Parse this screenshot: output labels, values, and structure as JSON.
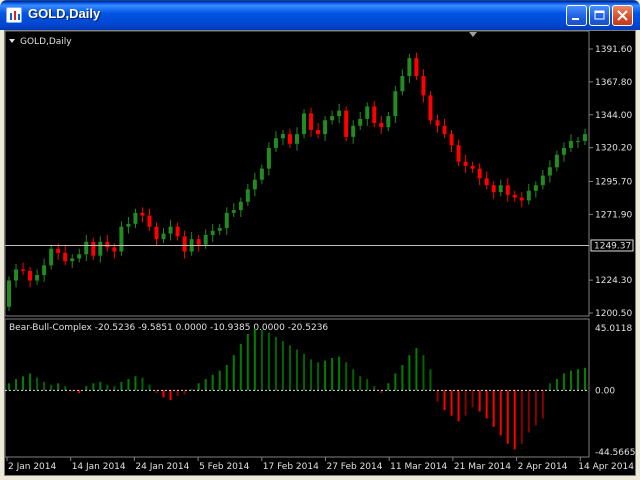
{
  "window": {
    "title": "GOLD,Daily",
    "icon": "chart-app-icon",
    "buttons": {
      "minimize": "minimize-icon",
      "maximize": "maximize-icon",
      "close": "close-icon"
    }
  },
  "main_chart": {
    "label": "GOLD,Daily",
    "current_price": "1249.37",
    "price_ticks": [
      "1391.60",
      "1367.80",
      "1344.00",
      "1320.20",
      "1295.70",
      "1271.90",
      "1249.37",
      "1224.30",
      "1200.50"
    ],
    "colors": {
      "bull": "#228b22",
      "bear": "#ff0000",
      "background": "#000000",
      "grid_line": "#c0c0c0"
    }
  },
  "indicator": {
    "label": "Bear-Bull-Complex -20.5236 -9.5851 0.0000 -10.9385 0.0000 -20.5236",
    "ticks": [
      "45.0118",
      "0.00",
      "-44.5665"
    ],
    "colors": {
      "bull_bright": "#008000",
      "bull_dark": "#006400",
      "bear_bright": "#ff0000",
      "bear_dark": "#8b0000"
    }
  },
  "time_axis": {
    "labels": [
      "2 Jan 2014",
      "14 Jan 2014",
      "24 Jan 2014",
      "5 Feb 2014",
      "17 Feb 2014",
      "27 Feb 2014",
      "11 Mar 2014",
      "21 Mar 2014",
      "2 Apr 2014",
      "14 Apr 2014"
    ]
  },
  "chart_data": [
    {
      "type": "candlestick",
      "title": "GOLD,Daily",
      "ylim": [
        1200.5,
        1391.6
      ],
      "x_start": "2 Jan 2014",
      "x_end": "15 Apr 2014",
      "close": [
        1224,
        1232,
        1231,
        1224,
        1228,
        1235,
        1247,
        1244,
        1238,
        1240,
        1243,
        1252,
        1242,
        1252,
        1248,
        1245,
        1263,
        1265,
        1273,
        1271,
        1263,
        1254,
        1258,
        1263,
        1256,
        1245,
        1254,
        1250,
        1257,
        1260,
        1262,
        1273,
        1275,
        1281,
        1290,
        1297,
        1305,
        1320,
        1327,
        1330,
        1323,
        1330,
        1345,
        1333,
        1330,
        1340,
        1343,
        1347,
        1328,
        1336,
        1341,
        1350,
        1338,
        1335,
        1343,
        1361,
        1372,
        1385,
        1372,
        1358,
        1340,
        1336,
        1330,
        1322,
        1310,
        1307,
        1305,
        1298,
        1293,
        1288,
        1293,
        1286,
        1284,
        1282,
        1289,
        1293,
        1300,
        1306,
        1315,
        1320,
        1325,
        1325,
        1330
      ]
    },
    {
      "type": "bar",
      "title": "Bear-Bull-Complex",
      "ylim": [
        -44.5665,
        45.0118
      ],
      "values": [
        5,
        8,
        10,
        12,
        9,
        6,
        4,
        5,
        3,
        -1,
        -2,
        3,
        5,
        6,
        4,
        3,
        6,
        8,
        10,
        9,
        4,
        -2,
        -5,
        -7,
        -4,
        -3,
        1,
        5,
        8,
        11,
        14,
        18,
        25,
        33,
        40,
        44,
        43,
        41,
        38,
        35,
        32,
        29,
        26,
        22,
        20,
        21,
        23,
        24,
        20,
        15,
        10,
        8,
        3,
        -2,
        5,
        12,
        18,
        25,
        30,
        25,
        15,
        -8,
        -14,
        -18,
        -22,
        -18,
        -12,
        -15,
        -20,
        -26,
        -32,
        -38,
        -42,
        -38,
        -30,
        -25,
        -20,
        5,
        8,
        12,
        14,
        15,
        16
      ]
    }
  ]
}
